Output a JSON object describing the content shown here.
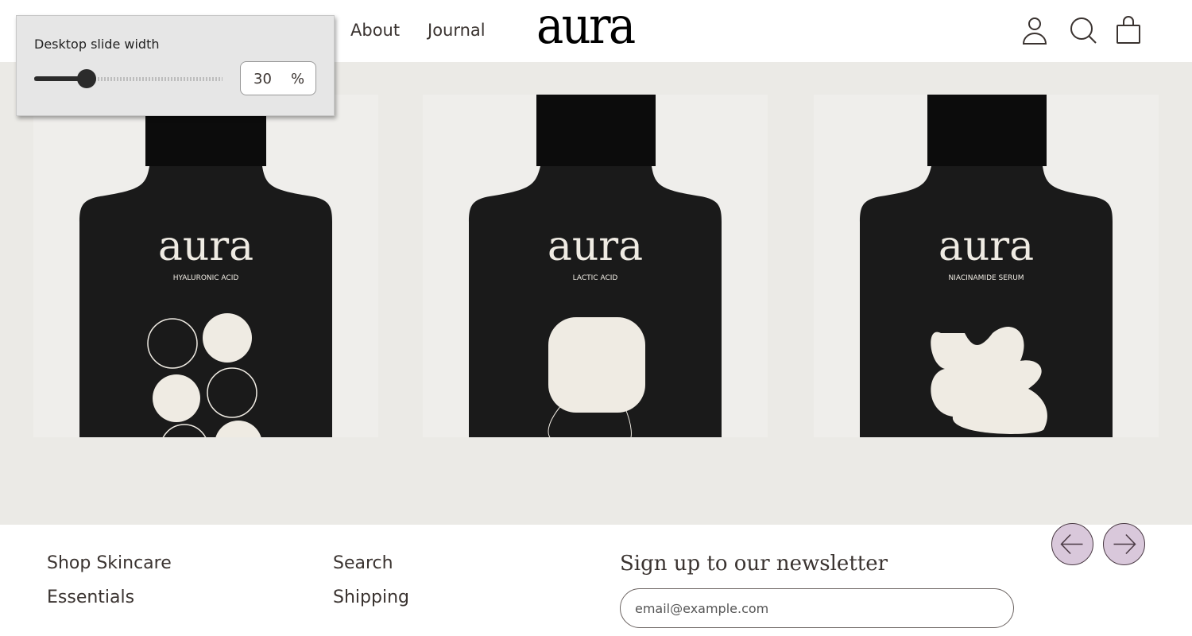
{
  "header": {
    "nav": [
      "About",
      "Journal"
    ],
    "logo": "aura",
    "icons": [
      "account-icon",
      "search-icon",
      "cart-icon"
    ]
  },
  "slides": [
    {
      "brand": "aura",
      "product": "HYALURONIC ACID"
    },
    {
      "brand": "aura",
      "product": "LACTIC ACID"
    },
    {
      "brand": "aura",
      "product": "NIACINAMIDE SERUM"
    }
  ],
  "carousel": {
    "prev": "previous-slide",
    "next": "next-slide",
    "accent": "#d9c8db"
  },
  "popup": {
    "label": "Desktop slide width",
    "value": "30",
    "unit": "%",
    "percent": 30
  },
  "footer": {
    "col1": [
      "Shop Skincare",
      "Essentials"
    ],
    "col2": [
      "Search",
      "Shipping"
    ],
    "newsletter_title": "Sign up to our newsletter",
    "email_placeholder": "email@example.com"
  }
}
